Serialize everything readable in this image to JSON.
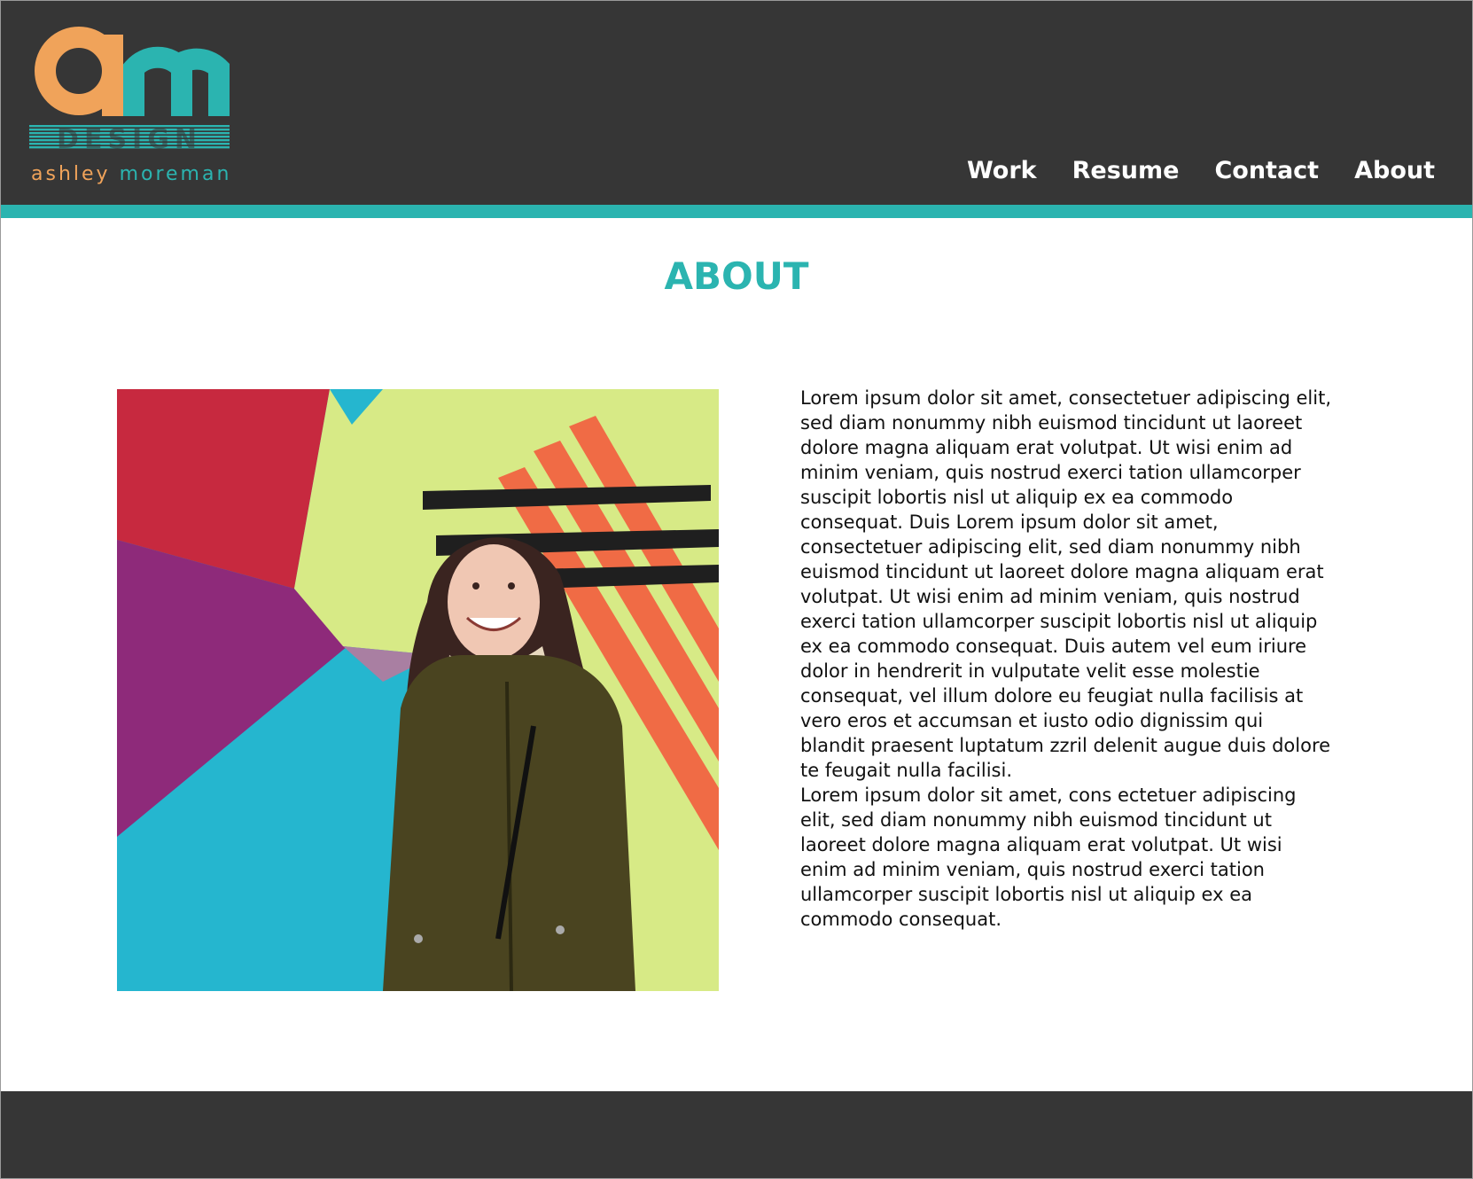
{
  "brand": {
    "logo_letters": "am",
    "logo_word": "DESIGN",
    "first_name": "ashley",
    "last_name": "moreman",
    "orange": "#f0a35a",
    "teal": "#2bb4b0"
  },
  "nav": {
    "items": [
      {
        "label": "Work"
      },
      {
        "label": "Resume"
      },
      {
        "label": "Contact"
      },
      {
        "label": "About"
      }
    ]
  },
  "main": {
    "title": "ABOUT",
    "paragraphs": [
      "Lorem ipsum dolor sit amet, consectetuer adipiscing elit, sed diam nonummy nibh euismod tincidunt ut laoreet dolore magna aliquam erat volutpat. Ut wisi enim ad minim veniam, quis nostrud exerci tation ullamcorper suscipit lobortis nisl ut aliquip ex ea commodo consequat. Duis Lorem ipsum dolor sit amet, consectetuer adipiscing elit, sed diam nonummy nibh euismod tincidunt ut laoreet dolore magna aliquam erat volutpat. Ut wisi enim ad minim veniam, quis nostrud exerci tation ullamcorper suscipit lobortis nisl ut aliquip ex ea commodo consequat. Duis autem vel eum iriure dolor in hendrerit in vulputate velit esse molestie consequat, vel illum dolore eu feugiat nulla facilisis at vero eros et accumsan et iusto odio dignissim qui blandit praesent luptatum zzril delenit augue duis dolore te feugait nulla facilisi.",
      "Lorem ipsum dolor sit amet, cons ectetuer adipiscing elit, sed diam nonummy nibh euismod tincidunt ut laoreet dolore magna aliquam erat volutpat. Ut wisi enim ad minim veniam, quis nostrud exerci tation ullamcorper suscipit lobortis nisl ut aliquip ex ea commodo consequat."
    ]
  },
  "colors": {
    "header_bg": "#363636",
    "accent": "#2bb4b0",
    "footer_bg": "#363636"
  }
}
